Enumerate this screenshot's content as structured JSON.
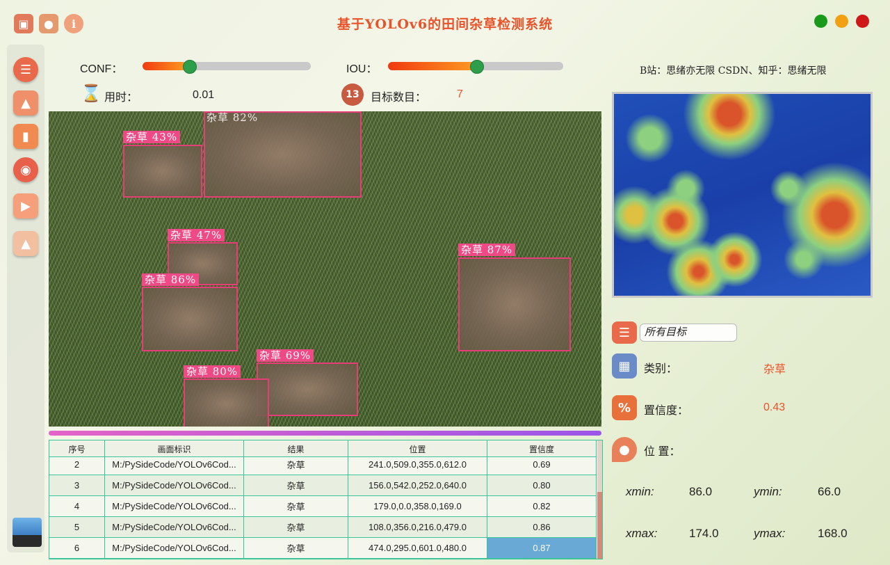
{
  "app": {
    "title": "基于YOLOv6的田间杂草检测系统",
    "credit": "B站：思绪亦无限  CSDN、知乎：思绪无限"
  },
  "controls": {
    "conf_label": "CONF：",
    "conf_value": 0.26,
    "iou_label": "IOU：",
    "iou_value": 0.5,
    "time_label": "用时：",
    "time_value": "0.01",
    "count_label": "目标数目：",
    "count_value": "7",
    "count_badge": "13"
  },
  "detections": [
    {
      "label": "杂草  43%"
    },
    {
      "label": "杂草  82%"
    },
    {
      "label": "杂草  47%"
    },
    {
      "label": "杂草  86%"
    },
    {
      "label": "杂草  87%"
    },
    {
      "label": "杂草  69%"
    },
    {
      "label": "杂草  80%"
    }
  ],
  "table": {
    "headers": [
      "序号",
      "画面标识",
      "结果",
      "位置",
      "置信度"
    ],
    "rows": [
      {
        "id": "2",
        "source": "M:/PySideCode/YOLOv6Cod...",
        "result": "杂草",
        "pos": "241.0,509.0,355.0,612.0",
        "conf": "0.69"
      },
      {
        "id": "3",
        "source": "M:/PySideCode/YOLOv6Cod...",
        "result": "杂草",
        "pos": "156.0,542.0,252.0,640.0",
        "conf": "0.80"
      },
      {
        "id": "4",
        "source": "M:/PySideCode/YOLOv6Cod...",
        "result": "杂草",
        "pos": "179.0,0.0,358.0,169.0",
        "conf": "0.82"
      },
      {
        "id": "5",
        "source": "M:/PySideCode/YOLOv6Cod...",
        "result": "杂草",
        "pos": "108.0,356.0,216.0,479.0",
        "conf": "0.86"
      },
      {
        "id": "6",
        "source": "M:/PySideCode/YOLOv6Cod...",
        "result": "杂草",
        "pos": "474.0,295.0,601.0,480.0",
        "conf": "0.87"
      }
    ]
  },
  "detail": {
    "target_select": "所有目标",
    "class_label": "类别：",
    "class_value": "杂草",
    "conf_label": "置信度：",
    "conf_value": "0.43",
    "pos_label": "位 置：",
    "xmin_label": "xmin:",
    "xmin_value": "86.0",
    "ymin_label": "ymin:",
    "ymin_value": "66.0",
    "xmax_label": "xmax:",
    "xmax_value": "174.0",
    "ymax_label": "ymax:",
    "ymax_value": "168.0"
  },
  "colors": {
    "accent": "#e8532a",
    "box": "#e63c78",
    "table_border": "#3ac49a",
    "selected_cell": "#69a9d6"
  }
}
